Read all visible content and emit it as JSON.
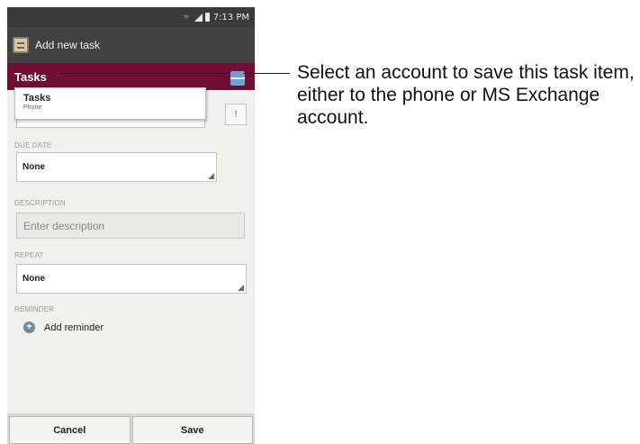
{
  "status_bar": {
    "time": "7:13 PM"
  },
  "action_bar": {
    "title": "Add new task"
  },
  "account_bar": {
    "label": "Tasks",
    "accent_color": "#6e0f34"
  },
  "account_dropdown": {
    "title": "Tasks",
    "subtitle": "Phone"
  },
  "form": {
    "due_date": {
      "label": "DUE DATE",
      "value": "None"
    },
    "description": {
      "label": "DESCRIPTION",
      "placeholder": "Enter description"
    },
    "repeat": {
      "label": "REPEAT",
      "value": "None"
    },
    "reminder": {
      "label": "REMINDER",
      "add_label": "Add reminder"
    }
  },
  "buttons": {
    "cancel": "Cancel",
    "save": "Save"
  },
  "callout": {
    "text": "Select an account to save this task item, either to the phone or MS Exchange account."
  },
  "icons": [
    "app-icon",
    "signal-icon",
    "battery-icon",
    "account-switch-icon",
    "priority-icon",
    "plus-icon"
  ]
}
